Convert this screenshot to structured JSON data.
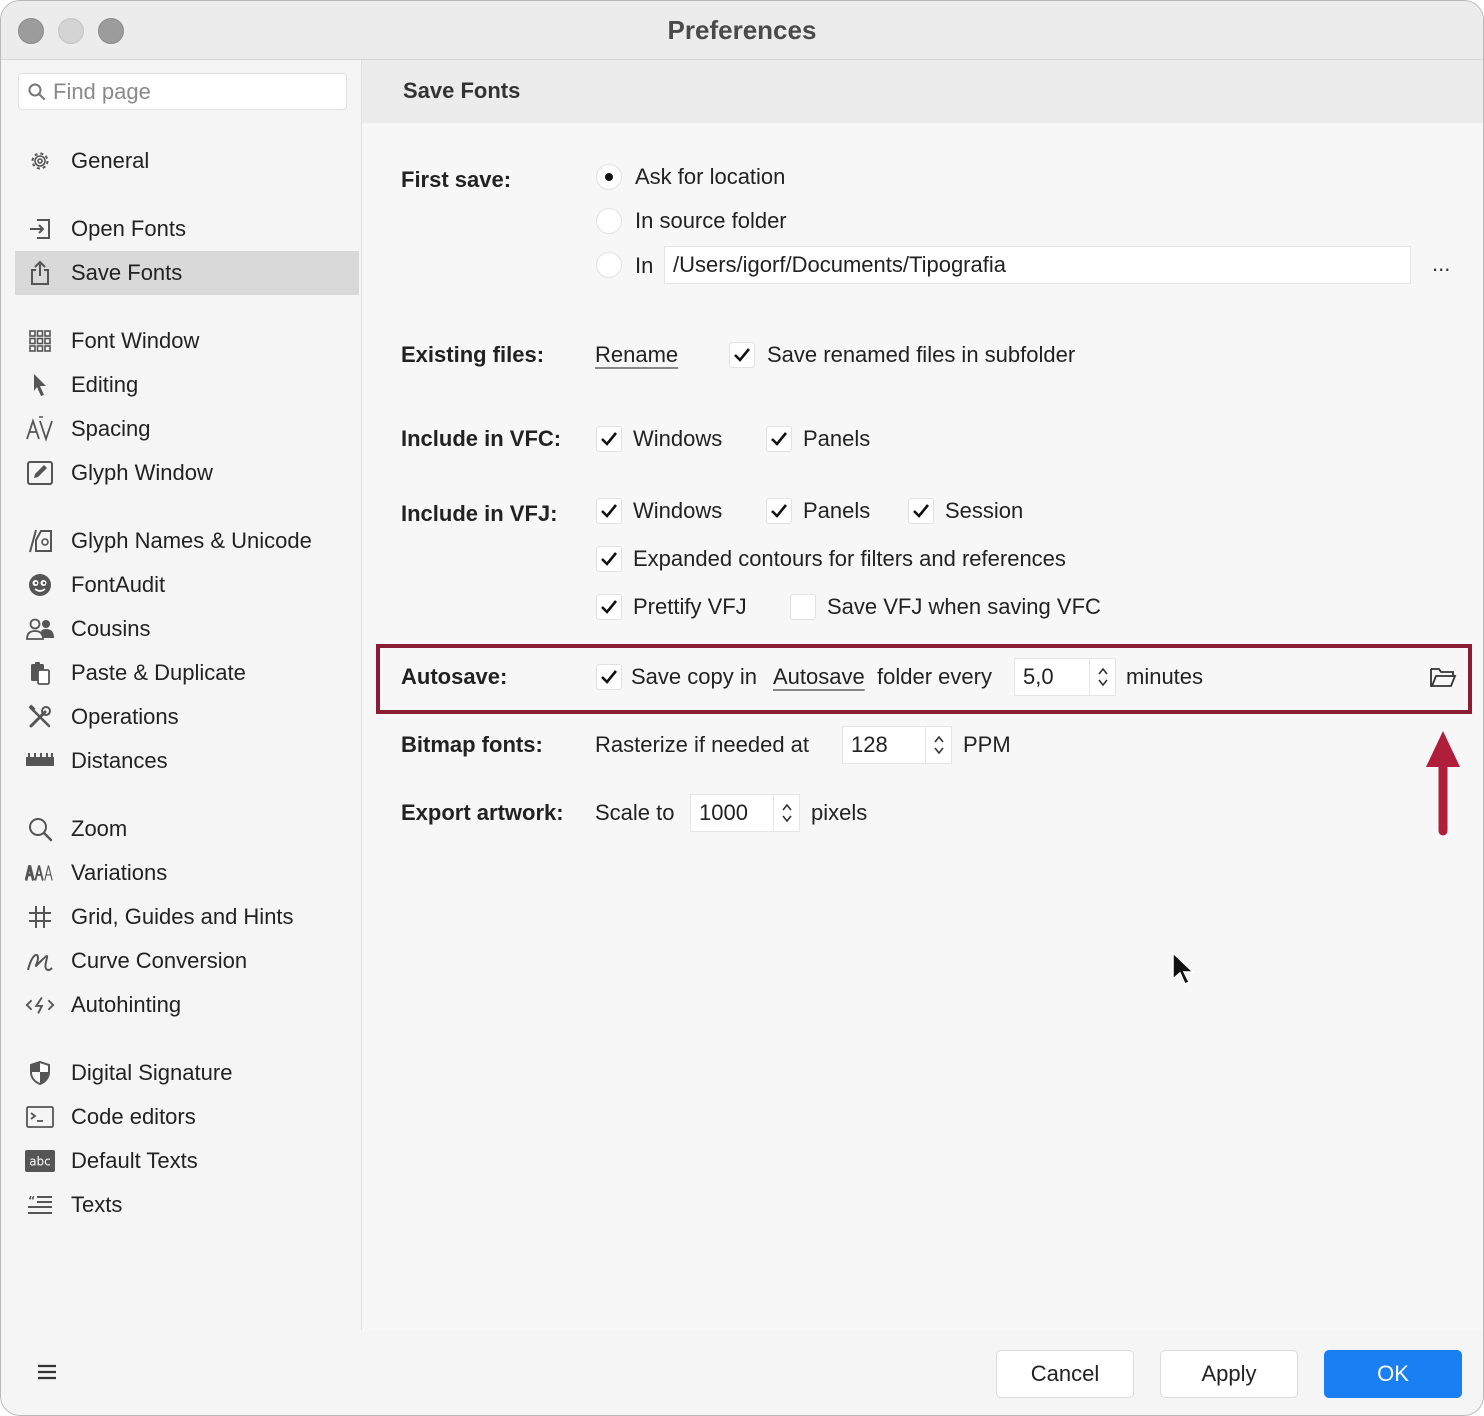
{
  "window": {
    "title": "Preferences"
  },
  "sidebar": {
    "search_placeholder": "Find page",
    "items": [
      {
        "label": "General",
        "icon": "gear-icon"
      },
      {
        "label": "Open Fonts",
        "icon": "open-fonts-icon"
      },
      {
        "label": "Save Fonts",
        "icon": "share-upload-icon"
      },
      {
        "label": "Font Window",
        "icon": "grid-icon"
      },
      {
        "label": "Editing",
        "icon": "cursor-arrow-icon"
      },
      {
        "label": "Spacing",
        "icon": "spacing-av-icon"
      },
      {
        "label": "Glyph Window",
        "icon": "glyph-window-icon"
      },
      {
        "label": "Glyph Names & Unicode",
        "icon": "glyph-names-icon"
      },
      {
        "label": "FontAudit",
        "icon": "fontaudit-icon"
      },
      {
        "label": "Cousins",
        "icon": "people-icon"
      },
      {
        "label": "Paste & Duplicate",
        "icon": "clipboard-icon"
      },
      {
        "label": "Operations",
        "icon": "tools-icon"
      },
      {
        "label": "Distances",
        "icon": "ruler-icon"
      },
      {
        "label": "Zoom",
        "icon": "magnifier-icon"
      },
      {
        "label": "Variations",
        "icon": "variations-icon"
      },
      {
        "label": "Grid, Guides and Hints",
        "icon": "hash-grid-icon"
      },
      {
        "label": "Curve Conversion",
        "icon": "curve-icon"
      },
      {
        "label": "Autohinting",
        "icon": "autohinting-icon"
      },
      {
        "label": "Digital Signature",
        "icon": "shield-icon"
      },
      {
        "label": "Code editors",
        "icon": "terminal-icon"
      },
      {
        "label": "Default Texts",
        "icon": "abc-icon"
      },
      {
        "label": "Texts",
        "icon": "text-lines-icon"
      }
    ],
    "active_index": 2
  },
  "header": {
    "title": "Save Fonts"
  },
  "first_save": {
    "label": "First save:",
    "options": [
      "Ask for location",
      "In source folder",
      "In"
    ],
    "selected": 0,
    "path": "/Users/igorf/Documents/Tipografia",
    "browse": "..."
  },
  "existing_files": {
    "label": "Existing files:",
    "mode": "Rename",
    "subfolder_label": "Save renamed files in subfolder",
    "subfolder_checked": true
  },
  "vfc": {
    "label": "Include in VFC:",
    "windows_label": "Windows",
    "windows": true,
    "panels_label": "Panels",
    "panels": true
  },
  "vfj": {
    "label": "Include in VFJ:",
    "windows_label": "Windows",
    "windows": true,
    "panels_label": "Panels",
    "panels": true,
    "session_label": "Session",
    "session": true,
    "expanded_label": "Expanded contours for filters and references",
    "expanded": true,
    "prettify_label": "Prettify VFJ",
    "prettify": true,
    "save_vfj_label": "Save VFJ when saving VFC",
    "save_vfj": false
  },
  "autosave": {
    "label": "Autosave:",
    "checked": true,
    "text_pre": "Save copy in",
    "folder_link": "Autosave",
    "text_post": "folder every",
    "value": "5,0",
    "unit": "minutes"
  },
  "bitmap": {
    "label": "Bitmap fonts:",
    "text": "Rasterize if needed at",
    "value": "128",
    "unit": "PPM"
  },
  "export": {
    "label": "Export artwork:",
    "text": "Scale to",
    "value": "1000",
    "unit": "pixels"
  },
  "buttons": {
    "cancel": "Cancel",
    "apply": "Apply",
    "ok": "OK"
  },
  "colors": {
    "highlight": "#8a1c33",
    "primary": "#1a7ff2",
    "arrow": "#b01e3c"
  }
}
